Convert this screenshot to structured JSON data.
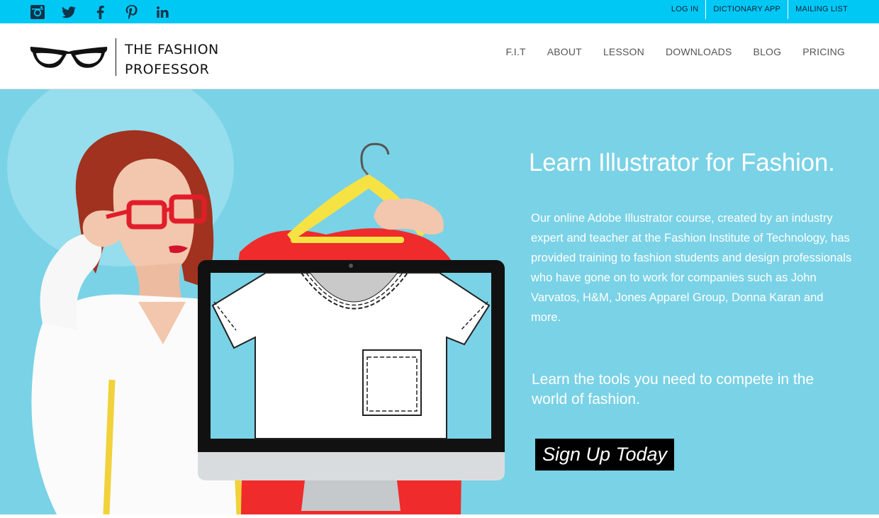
{
  "colors": {
    "topbar": "#00c8f5",
    "hero_bg": "#7ad2e6",
    "button_bg": "#000000",
    "text_light": "#ffffff"
  },
  "social_icons": [
    "instagram-icon",
    "twitter-icon",
    "facebook-icon",
    "pinterest-icon",
    "linkedin-icon"
  ],
  "utility_links": {
    "login": "LOG IN",
    "dictionary": "DICTIONARY APP",
    "mailing": "MAILING LIST"
  },
  "logo": {
    "line1": "THE FASHION",
    "line2": "PROFESSOR"
  },
  "nav": {
    "fit": "F.I.T",
    "about": "ABOUT",
    "lesson": "LESSON",
    "downloads": "DOWNLOADS",
    "blog": "BLOG",
    "pricing": "PRICING"
  },
  "hero": {
    "title": "Learn Illustrator for Fashion.",
    "body": "Our online Adobe Illustrator course, created by an industry expert and teacher at the Fashion Institute of Technology, has provided training to fashion students and design professionals who have gone on to work for companies such as John Varvatos, H&M, Jones Apparel Group, Donna Karan and more.",
    "tagline": "Learn the tools you need to compete in the world of fashion.",
    "cta": "Sign Up Today"
  }
}
